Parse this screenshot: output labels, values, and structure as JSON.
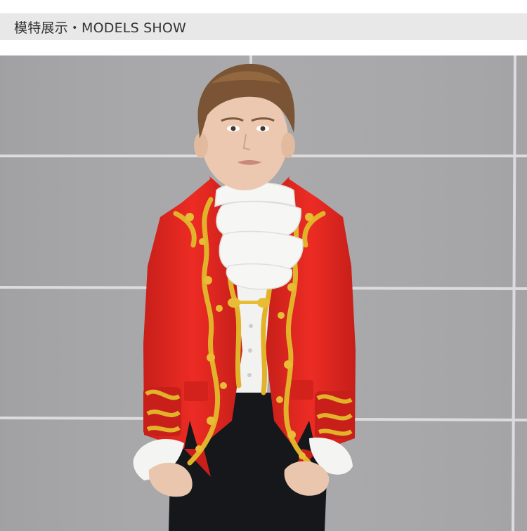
{
  "header": {
    "title": "模特展示・MODELS SHOW"
  },
  "photo": {
    "subject": "model-photo",
    "colors": {
      "wall": "#a9a9ab",
      "grout": "#d9d9db",
      "jacket": "#e3261f",
      "jacket_shadow": "#b51a16",
      "embroidery": "#e2b32a",
      "lace": "#f4f4f2",
      "trousers": "#15171b",
      "hair": "#7a5434",
      "skin": "#e9c6ad"
    }
  }
}
